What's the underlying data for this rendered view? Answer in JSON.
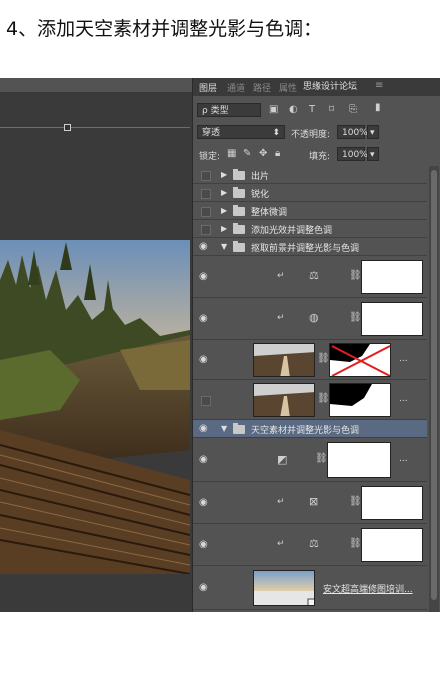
{
  "heading": "4、添加天空素材并调整光影与色调：",
  "panel": {
    "tabs": [
      "图层",
      "通道",
      "路径",
      "属性"
    ],
    "watermark": "思缘设计论坛",
    "filter_label": "ρ 类型",
    "blend_mode": "穿透",
    "opacity_label": "不透明度:",
    "opacity_value": "100%",
    "lock_label": "锁定:",
    "fill_label": "填充:",
    "fill_value": "100%"
  },
  "layers": [
    {
      "name": "出片",
      "type": "group",
      "collapsed": true,
      "visible": false
    },
    {
      "name": "锐化",
      "type": "group",
      "collapsed": true,
      "visible": false
    },
    {
      "name": "整体微调",
      "type": "group",
      "collapsed": true,
      "visible": false
    },
    {
      "name": "添加光效并调整色调",
      "type": "group",
      "collapsed": true,
      "visible": false
    },
    {
      "name": "抠取前景并调整光影与色调",
      "type": "group",
      "collapsed": false,
      "visible": true
    },
    {
      "name": "天空素材并调整光影与色调",
      "type": "group",
      "collapsed": false,
      "visible": true,
      "selected": true
    },
    {
      "name": "安文超高端修图培训...",
      "type": "layer",
      "visible": true
    }
  ],
  "colors": {
    "panel_bg": "#535353",
    "selected_row": "#5a6a82",
    "canvas_bg": "#282828"
  }
}
